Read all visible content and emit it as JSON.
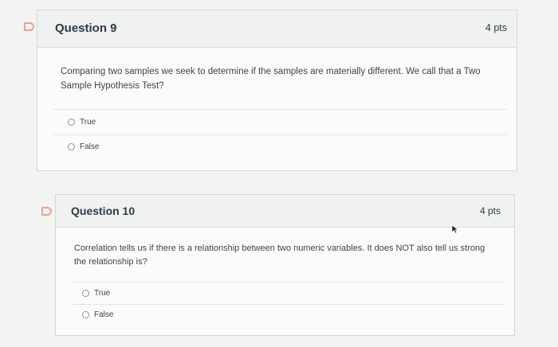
{
  "questions": [
    {
      "title": "Question 9",
      "points": "4 pts",
      "text": "Comparing two samples we seek to determine if the samples are materially different. We call that a Two Sample Hypothesis Test?",
      "answers": [
        "True",
        "False"
      ]
    },
    {
      "title": "Question 10",
      "points": "4 pts",
      "text": "Correlation tells us if there is a relationship between two numeric variables. It does NOT also tell us strong the relationship is?",
      "answers": [
        "True",
        "False"
      ]
    }
  ],
  "icons": {
    "flag": "flag-icon",
    "cursor": "mouse-cursor-icon"
  },
  "colors": {
    "flag": "#e8a398",
    "header_bg": "#f0f1f1",
    "border": "#d4d6d8"
  }
}
